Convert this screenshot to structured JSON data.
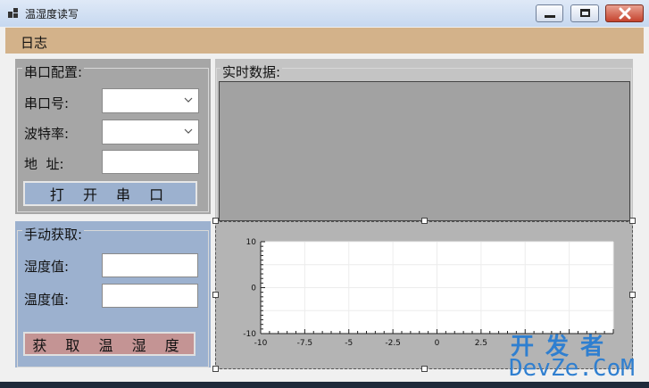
{
  "window": {
    "title": "温湿度读写",
    "controls": [
      "minimize",
      "maximize",
      "close"
    ]
  },
  "menu": {
    "items": [
      {
        "label": "日志"
      }
    ]
  },
  "serial_config": {
    "title": "串口配置:",
    "port_label": "串口号:",
    "port_value": "",
    "baud_label": "波特率:",
    "baud_value": "",
    "address_label": "地  址:",
    "address_value": "",
    "open_button": "打 开 串 口"
  },
  "manual_fetch": {
    "title": "手动获取:",
    "humidity_label": "湿度值:",
    "humidity_value": "",
    "temperature_label": "温度值:",
    "temperature_value": "",
    "fetch_button": "获 取 温 湿 度"
  },
  "realtime": {
    "title": "实时数据:"
  },
  "chart_data": {
    "type": "line",
    "title": "",
    "xlabel": "",
    "ylabel": "",
    "xlim": [
      -10,
      10
    ],
    "ylim": [
      -10,
      10
    ],
    "x_ticks": [
      "-10",
      "-7.5",
      "-5",
      "-2.5",
      "0",
      "2.5"
    ],
    "y_ticks": [
      "10",
      "0",
      "-10"
    ],
    "grid": true,
    "series": []
  },
  "watermark": {
    "line1": "开 发 者",
    "line2": "DevZe.CoM"
  },
  "colors": {
    "menubar": "#d3b28a",
    "serial_panel": "#a6a6a6",
    "manual_panel": "#9cb1cf",
    "open_button": "#9cb1cf",
    "fetch_button": "#c49494",
    "realtime_panel": "#c4c4c4",
    "realtime_area": "#a2a2a2",
    "watermark": "#2f7fd0"
  }
}
